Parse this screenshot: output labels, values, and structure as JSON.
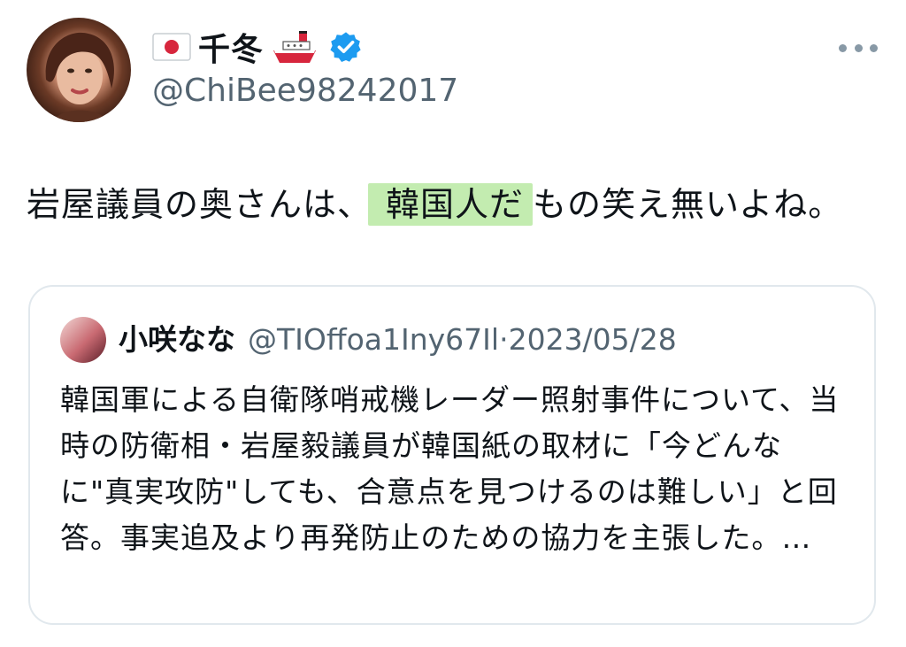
{
  "author": {
    "display_name": "千冬",
    "handle": "@ChiBee98242017",
    "badges": [
      "japan-flag-icon",
      "ship-icon",
      "verified-badge-icon"
    ]
  },
  "tweet": {
    "text_before": "岩屋議員の奥さんは、",
    "text_highlight": "韓国人だ",
    "text_after": "もの笑え無いよね。"
  },
  "quote": {
    "name": "小咲なな",
    "handle": "@TIOffoa1Iny67Il",
    "separator": "·",
    "date": "2023/05/28",
    "text": "韓国軍による自衛隊哨戒機レーダー照射事件について、当時の防衛相・岩屋毅議員が韓国紙の取材に「今どんなに\"真実攻防\"しても、合意点を見つけるのは難しい」と回答。事実追及より再発防止のための協力を主張した。…"
  },
  "colors": {
    "verified": "#1d9bf0",
    "secondary_text": "#536471",
    "highlight": "#c3ecb0",
    "card_border": "#e1e8ed"
  }
}
